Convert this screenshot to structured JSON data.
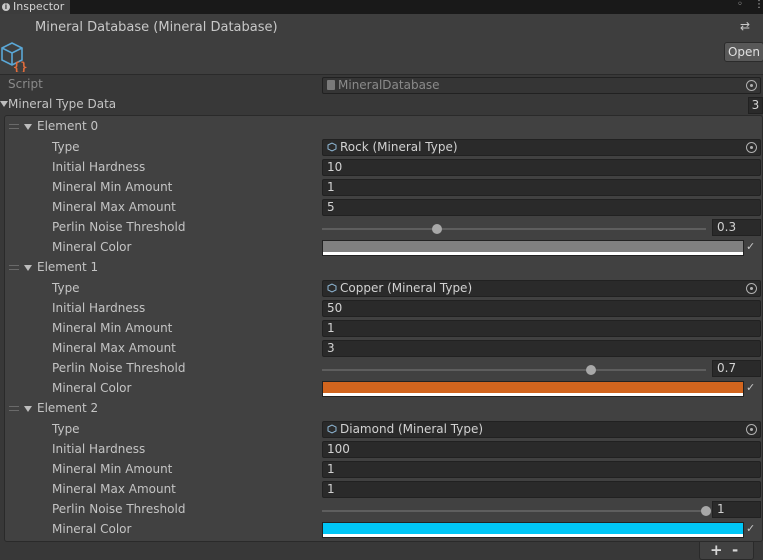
{
  "tab": {
    "title": "Inspector"
  },
  "header": {
    "title": "Mineral Database (Mineral Database)",
    "open_label": "Open"
  },
  "script_row": {
    "label": "Script",
    "value": "MineralDatabase"
  },
  "array": {
    "label": "Mineral Type Data",
    "count": "3"
  },
  "elements": [
    {
      "label": "Element 0",
      "type_label": "Type",
      "type_value": "Rock (Mineral Type)",
      "hardness_label": "Initial Hardness",
      "hardness": "10",
      "min_label": "Mineral Min Amount",
      "min": "1",
      "max_label": "Mineral Max Amount",
      "max": "5",
      "perlin_label": "Perlin Noise Threshold",
      "perlin": "0.3",
      "color_label": "Mineral Color",
      "color": "#808080"
    },
    {
      "label": "Element 1",
      "type_label": "Type",
      "type_value": "Copper (Mineral Type)",
      "hardness_label": "Initial Hardness",
      "hardness": "50",
      "min_label": "Mineral Min Amount",
      "min": "1",
      "max_label": "Mineral Max Amount",
      "max": "3",
      "perlin_label": "Perlin Noise Threshold",
      "perlin": "0.7",
      "color_label": "Mineral Color",
      "color": "#d2651e"
    },
    {
      "label": "Element 2",
      "type_label": "Type",
      "type_value": "Diamond (Mineral Type)",
      "hardness_label": "Initial Hardness",
      "hardness": "100",
      "min_label": "Mineral Min Amount",
      "min": "1",
      "max_label": "Mineral Max Amount",
      "max": "1",
      "perlin_label": "Perlin Noise Threshold",
      "perlin": "1",
      "color_label": "Mineral Color",
      "color": "#00c6f6"
    }
  ],
  "footer": {
    "add_label": "+",
    "remove_label": "-"
  },
  "icons": {
    "tab": "info-icon",
    "lock": "lock-icon",
    "menu": "kebab-menu-icon",
    "asset": "scriptable-object-icon",
    "settings": "sliders-icon",
    "picker": "object-picker-icon",
    "eyedropper": "eyedropper-icon"
  },
  "colors": {
    "accent_icon": "#5aa7d6",
    "badge": "#e06c3c"
  }
}
